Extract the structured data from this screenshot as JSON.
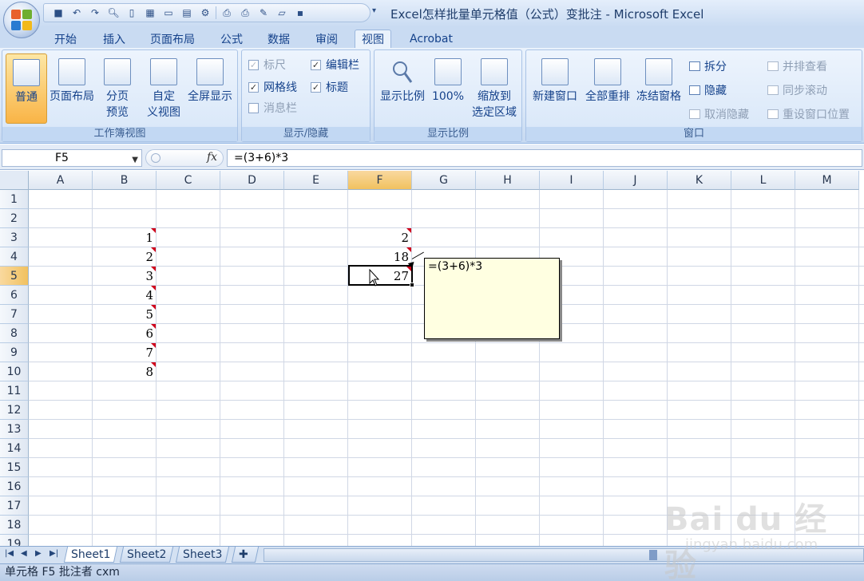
{
  "window": {
    "title": "Excel怎样批量单元格值（公式）变批注 - Microsoft Excel"
  },
  "quick_access": {
    "icons": [
      "save-icon",
      "undo-icon",
      "redo-icon",
      "print-preview-icon",
      "new-icon",
      "table-icon",
      "comment-icon",
      "form-icon",
      "tools-icon",
      "printer-icon",
      "print-icon",
      "pen-icon",
      "open-icon",
      "misc-icon"
    ],
    "more_arrow": "▾"
  },
  "ribbon_tabs": [
    "开始",
    "插入",
    "页面布局",
    "公式",
    "数据",
    "审阅",
    "视图",
    "Acrobat"
  ],
  "ribbon_active_tab": "视图",
  "groups": {
    "workbook_views": {
      "label": "工作簿视图",
      "buttons": [
        {
          "label": "普通",
          "active": true
        },
        {
          "label": "页面布局"
        },
        {
          "label": "分页\n预览"
        },
        {
          "label": "自定\n义视图"
        },
        {
          "label": "全屏显示"
        }
      ]
    },
    "show_hide": {
      "label": "显示/隐藏",
      "items": [
        {
          "label": "标尺",
          "checked": true,
          "disabled": true
        },
        {
          "label": "编辑栏",
          "checked": true
        },
        {
          "label": "网格线",
          "checked": true
        },
        {
          "label": "标题",
          "checked": true
        },
        {
          "label": "消息栏",
          "checked": false,
          "disabled": true
        }
      ]
    },
    "zoom": {
      "label": "显示比例",
      "buttons": [
        {
          "label": "显示比例"
        },
        {
          "label": "100%"
        },
        {
          "label": "缩放到\n选定区域"
        }
      ]
    },
    "window": {
      "label": "窗口",
      "buttons": [
        {
          "label": "新建窗口"
        },
        {
          "label": "全部重排"
        },
        {
          "label": "冻结窗格"
        }
      ],
      "small": [
        {
          "label": "拆分"
        },
        {
          "label": "隐藏"
        },
        {
          "label": "取消隐藏",
          "disabled": true
        },
        {
          "label": "并排查看",
          "disabled": true
        },
        {
          "label": "同步滚动",
          "disabled": true
        },
        {
          "label": "重设窗口位置",
          "disabled": true
        }
      ]
    }
  },
  "formula_bar": {
    "name_box": "F5",
    "fx": "fx",
    "formula": "=(3+6)*3"
  },
  "sheet": {
    "columns": [
      "A",
      "B",
      "C",
      "D",
      "E",
      "F",
      "G",
      "H",
      "I",
      "J",
      "K",
      "L",
      "M"
    ],
    "rows": [
      "1",
      "2",
      "3",
      "4",
      "5",
      "6",
      "7",
      "8",
      "9",
      "10",
      "11",
      "12",
      "13",
      "14",
      "15",
      "16",
      "17",
      "18",
      "19"
    ],
    "selected_column": "F",
    "selected_row": "5",
    "column_b": [
      "1",
      "2",
      "3",
      "4",
      "5",
      "6",
      "7",
      "8"
    ],
    "column_f": [
      "2",
      "18",
      "27"
    ],
    "comment_text": "=(3+6)*3"
  },
  "sheet_tabs": [
    "Sheet1",
    "Sheet2",
    "Sheet3"
  ],
  "active_sheet": "Sheet1",
  "status_bar": {
    "text": "单元格 F5 批注者 cxm"
  },
  "watermark": {
    "logo": "Bai du 经验",
    "url": "jingyan.baidu.com"
  },
  "colors": {
    "accent": "#15428b",
    "comment_bg": "#ffffe1",
    "comment_marker": "#d0021b",
    "selected_header": "#f1c15f"
  }
}
